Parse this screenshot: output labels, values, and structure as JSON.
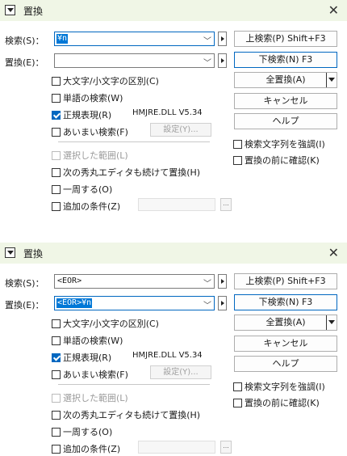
{
  "dialogs": [
    {
      "title": "置換",
      "search_label": "検索(S)：",
      "search_value": "¥n",
      "search_selected": true,
      "replace_label": "置換(E)：",
      "replace_value": "",
      "replace_selected": false,
      "buttons": {
        "up_search": "上検索(P) Shift+F3",
        "down_search": "下検索(N) F3",
        "replace_all": "全置換(A)",
        "cancel": "キャンセル",
        "help": "ヘルプ"
      },
      "options": {
        "case": "大文字/小文字の区別(C)",
        "word": "単語の検索(W)",
        "regex": "正規表現(R)",
        "fuzzy": "あいまい検索(F)",
        "settings_button": "設定(Y)...",
        "dll": "HMJRE.DLL V5.34",
        "selection": "選択した範囲(L)",
        "next_editor": "次の秀丸エディタも続けて置換(H)",
        "wrap": "一周する(O)",
        "extra": "追加の条件(Z)",
        "extra_button": "..."
      },
      "right_options": {
        "highlight": "検索文字列を強調(I)",
        "confirm": "置換の前に確認(K)"
      },
      "checked": {
        "regex": true
      }
    },
    {
      "title": "置換",
      "search_label": "検索(S)：",
      "search_value": "<EOR>",
      "search_selected": false,
      "replace_label": "置換(E)：",
      "replace_value": "<EOR>¥n",
      "replace_selected": true,
      "buttons": {
        "up_search": "上検索(P) Shift+F3",
        "down_search": "下検索(N) F3",
        "replace_all": "全置換(A)",
        "cancel": "キャンセル",
        "help": "ヘルプ"
      },
      "options": {
        "case": "大文字/小文字の区別(C)",
        "word": "単語の検索(W)",
        "regex": "正規表現(R)",
        "fuzzy": "あいまい検索(F)",
        "settings_button": "設定(Y)...",
        "dll": "HMJRE.DLL V5.34",
        "selection": "選択した範囲(L)",
        "next_editor": "次の秀丸エディタも続けて置換(H)",
        "wrap": "一周する(O)",
        "extra": "追加の条件(Z)",
        "extra_button": "..."
      },
      "right_options": {
        "highlight": "検索文字列を強調(I)",
        "confirm": "置換の前に確認(K)"
      },
      "checked": {
        "regex": true
      }
    }
  ],
  "icons": {
    "system_menu": "dropdown-triangle-icon",
    "close": "close-icon"
  },
  "colors": {
    "titlebar": "#f0f6e6",
    "accent": "#0067c0",
    "selection": "#0078d7"
  }
}
